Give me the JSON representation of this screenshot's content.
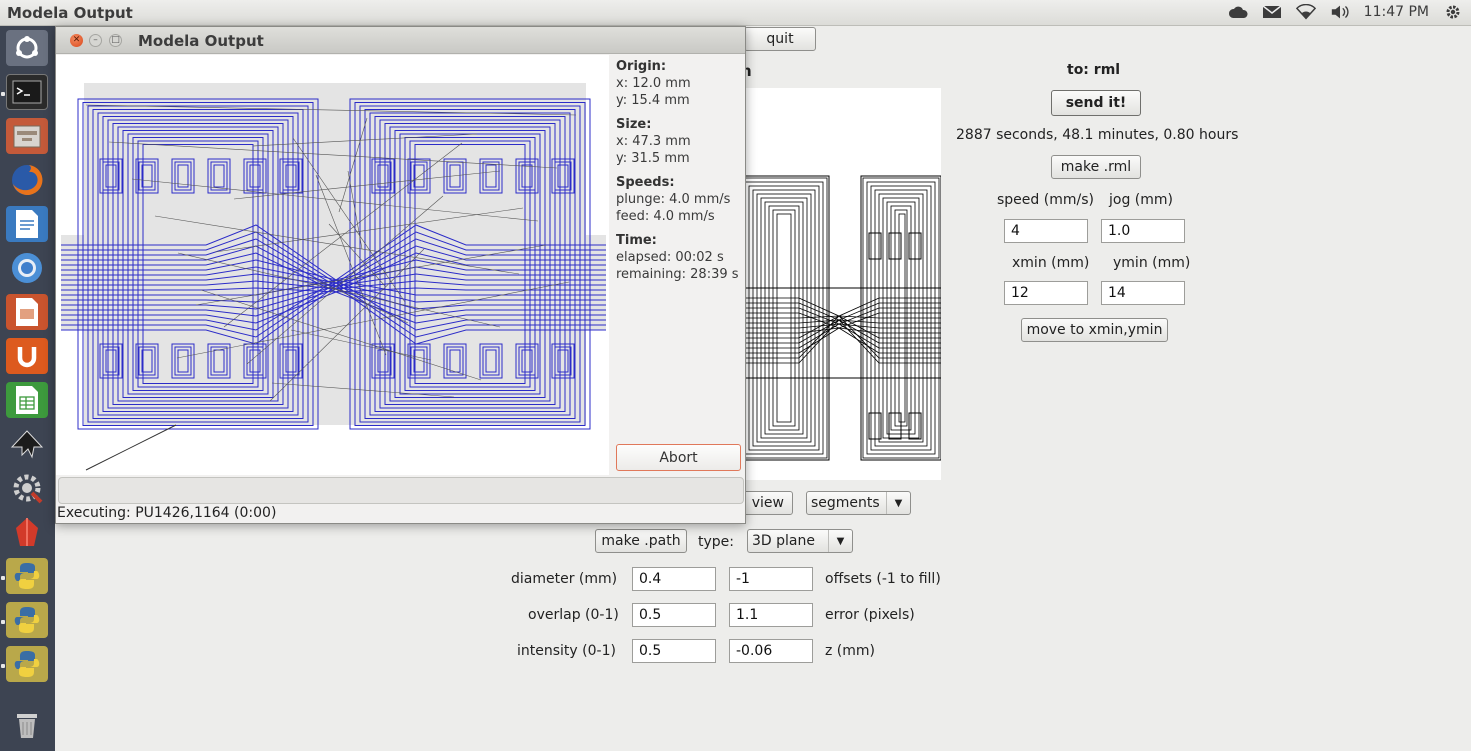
{
  "top_panel": {
    "app_title": "Modela Output",
    "clock": "11:47 PM",
    "indicators": [
      "cloud-icon",
      "mail-icon",
      "wifi-icon",
      "volume-icon",
      "gear-icon"
    ]
  },
  "launcher": {
    "items": [
      "dash-icon",
      "terminal-icon",
      "files-icon",
      "firefox-icon",
      "writer-icon",
      "chromium-icon",
      "impress-icon",
      "ubuntu-one-icon",
      "calc-icon",
      "inkscape-icon",
      "settings-icon",
      "app-icon",
      "python-icon",
      "python-icon",
      "python-icon",
      "trash-icon"
    ]
  },
  "background_app": {
    "quit_label": "quit",
    "to_label": "to: rml",
    "send_label": "send it!",
    "time_estimate": "2887 seconds, 48.1 minutes, 0.80 hours",
    "make_rml_label": "make .rml",
    "speed_label": "speed (mm/s)",
    "jog_label": "jog (mm)",
    "speed_value": "4",
    "jog_value": "1.0",
    "xmin_label": "xmin (mm)",
    "ymin_label": "ymin (mm)",
    "xmin_value": "12",
    "ymin_value": "14",
    "move_label": "move to xmin,ymin",
    "view_label": "view",
    "segments_value": "segments",
    "make_path_label": "make .path",
    "type_label": "type:",
    "type_value": "3D plane",
    "diameter_label": "diameter (mm)",
    "diameter_value": "0.4",
    "offsets_value": "-1",
    "offsets_label": "offsets (-1 to fill)",
    "overlap_label": "overlap (0-1)",
    "overlap_value": "0.5",
    "error_value": "1.1",
    "error_label": "error (pixels)",
    "intensity_label": "intensity (0-1)",
    "intensity_value": "0.5",
    "z_value": "-0.06",
    "z_label": "z (mm)"
  },
  "dialog": {
    "title": "Modela Output",
    "origin_heading": "Origin:",
    "origin_x": "x: 12.0 mm",
    "origin_y": "y: 15.4 mm",
    "size_heading": "Size:",
    "size_x": "x: 47.3 mm",
    "size_y": "y: 31.5 mm",
    "speeds_heading": "Speeds:",
    "plunge": "plunge: 4.0 mm/s",
    "feed": "feed: 4.0 mm/s",
    "time_heading": "Time:",
    "elapsed": "elapsed: 00:02 s",
    "remaining": "remaining: 28:39 s",
    "abort_label": "Abort",
    "status": "Executing: PU1426,1164 (0:00)"
  },
  "colors": {
    "toolpath": "#2c2cc8",
    "launcher_bg": "#3d4452",
    "abort_border": "#e0785a"
  }
}
